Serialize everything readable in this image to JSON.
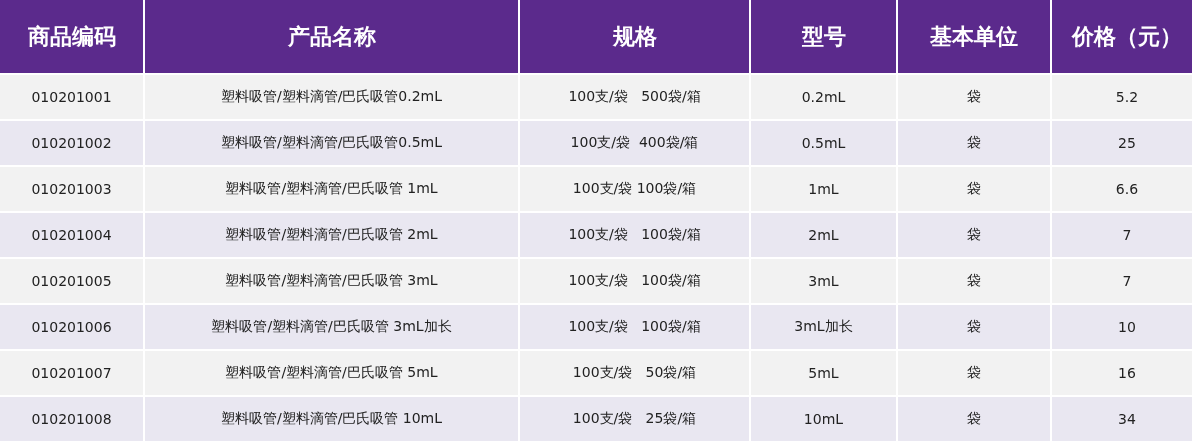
{
  "table": {
    "columns": [
      "商品编码",
      "产品名称",
      "规格",
      "型号",
      "基本单位",
      "价格（元）"
    ],
    "rows": [
      [
        "010201001",
        "塑料吸管/塑料滴管/巴氏吸管0.2mL",
        "100支/袋   500袋/箱",
        "0.2mL",
        "袋",
        "5.2"
      ],
      [
        "010201002",
        "塑料吸管/塑料滴管/巴氏吸管0.5mL",
        "100支/袋  400袋/箱",
        "0.5mL",
        "袋",
        "25"
      ],
      [
        "010201003",
        "塑料吸管/塑料滴管/巴氏吸管 1mL",
        "100支/袋 100袋/箱",
        "1mL",
        "袋",
        "6.6"
      ],
      [
        "010201004",
        "塑料吸管/塑料滴管/巴氏吸管 2mL",
        "100支/袋   100袋/箱",
        "2mL",
        "袋",
        "7"
      ],
      [
        "010201005",
        "塑料吸管/塑料滴管/巴氏吸管 3mL",
        "100支/袋   100袋/箱",
        "3mL",
        "袋",
        "7"
      ],
      [
        "010201006",
        "塑料吸管/塑料滴管/巴氏吸管 3mL加长",
        "100支/袋   100袋/箱",
        "3mL加长",
        "袋",
        "10"
      ],
      [
        "010201007",
        "塑料吸管/塑料滴管/巴氏吸管 5mL",
        "100支/袋   50袋/箱",
        "5mL",
        "袋",
        "16"
      ],
      [
        "010201008",
        "塑料吸管/塑料滴管/巴氏吸管 10mL",
        "100支/袋   25袋/箱",
        "10mL",
        "袋",
        "34"
      ]
    ]
  }
}
